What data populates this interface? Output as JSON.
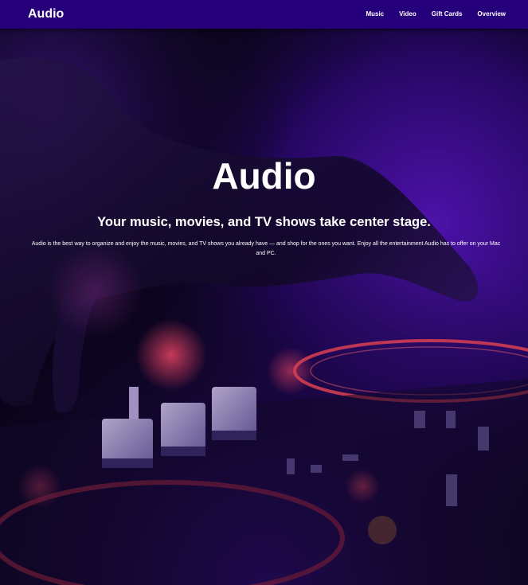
{
  "navbar": {
    "brand": "Audio",
    "links": [
      {
        "label": "Music"
      },
      {
        "label": "Video"
      },
      {
        "label": "Gift Cards"
      },
      {
        "label": "Overview"
      }
    ]
  },
  "hero": {
    "title": "Audio",
    "subtitle": "Your music, movies, and TV shows take center stage.",
    "body": "Audio is the best way to organize and enjoy the music, movies, and TV shows you already have — and shop for the ones you want. Enjoy all the entertainment Audio has to offer on your Mac and PC.",
    "background_image": "dj-mixer-hand-purple-light"
  },
  "colors": {
    "navbar_bg": "#25007a",
    "text": "#ffffff",
    "accent_purple": "#6a1bd6",
    "accent_red": "#ff3b4e"
  }
}
